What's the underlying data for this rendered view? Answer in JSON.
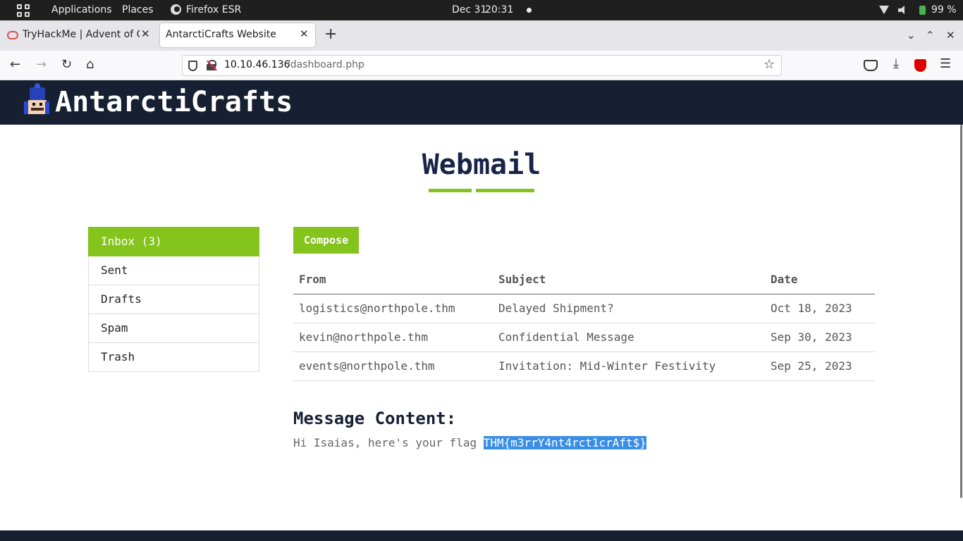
{
  "desktop": {
    "applications_label": "Applications",
    "places_label": "Places",
    "firefox_label": "Firefox ESR",
    "date": "Dec 31",
    "time": "20:31",
    "battery": "99 %"
  },
  "browser": {
    "tabs": [
      {
        "title": "TryHackMe | Advent of Cyber",
        "close": "✕"
      },
      {
        "title": "AntarctiCrafts Website",
        "close": "✕"
      }
    ],
    "new_tab": "+",
    "url_host": "10.10.46.136",
    "url_path": "/dashboard.php"
  },
  "site": {
    "title": "AntarctiCrafts",
    "heading": "Webmail",
    "accent_color": "#84c41d",
    "header_color": "#172033"
  },
  "sidebar": {
    "items": [
      {
        "label": "Inbox (3)",
        "active": true
      },
      {
        "label": "Sent"
      },
      {
        "label": "Drafts"
      },
      {
        "label": "Spam"
      },
      {
        "label": "Trash"
      }
    ]
  },
  "compose_label": "Compose",
  "table": {
    "headers": [
      "From",
      "Subject",
      "Date"
    ],
    "rows": [
      {
        "from": "logistics@northpole.thm",
        "subject": "Delayed Shipment?",
        "date": "Oct 18, 2023"
      },
      {
        "from": "kevin@northpole.thm",
        "subject": "Confidential Message",
        "date": "Sep 30, 2023"
      },
      {
        "from": "events@northpole.thm",
        "subject": "Invitation: Mid-Winter Festivity",
        "date": "Sep 25, 2023"
      }
    ]
  },
  "message": {
    "heading": "Message Content:",
    "text": "Hi Isaias, here's your flag ",
    "flag": "THM{m3rrY4nt4rct1crAft$}"
  }
}
